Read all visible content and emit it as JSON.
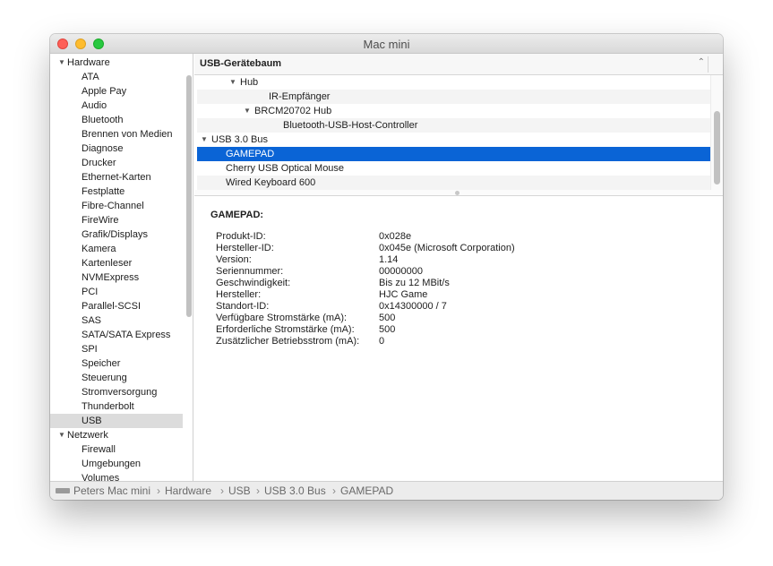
{
  "window": {
    "title": "Mac mini"
  },
  "sidebar": {
    "rows": [
      {
        "label": "Hardware",
        "type": "group"
      },
      {
        "label": "ATA",
        "type": "item"
      },
      {
        "label": "Apple Pay",
        "type": "item"
      },
      {
        "label": "Audio",
        "type": "item"
      },
      {
        "label": "Bluetooth",
        "type": "item"
      },
      {
        "label": "Brennen von Medien",
        "type": "item"
      },
      {
        "label": "Diagnose",
        "type": "item"
      },
      {
        "label": "Drucker",
        "type": "item"
      },
      {
        "label": "Ethernet-Karten",
        "type": "item"
      },
      {
        "label": "Festplatte",
        "type": "item"
      },
      {
        "label": "Fibre-Channel",
        "type": "item"
      },
      {
        "label": "FireWire",
        "type": "item"
      },
      {
        "label": "Grafik/Displays",
        "type": "item"
      },
      {
        "label": "Kamera",
        "type": "item"
      },
      {
        "label": "Kartenleser",
        "type": "item"
      },
      {
        "label": "NVMExpress",
        "type": "item"
      },
      {
        "label": "PCI",
        "type": "item"
      },
      {
        "label": "Parallel-SCSI",
        "type": "item"
      },
      {
        "label": "SAS",
        "type": "item"
      },
      {
        "label": "SATA/SATA Express",
        "type": "item"
      },
      {
        "label": "SPI",
        "type": "item"
      },
      {
        "label": "Speicher",
        "type": "item"
      },
      {
        "label": "Steuerung",
        "type": "item"
      },
      {
        "label": "Stromversorgung",
        "type": "item"
      },
      {
        "label": "Thunderbolt",
        "type": "item"
      },
      {
        "label": "USB",
        "type": "item",
        "selected": true
      },
      {
        "label": "Netzwerk",
        "type": "group"
      },
      {
        "label": "Firewall",
        "type": "item"
      },
      {
        "label": "Umgebungen",
        "type": "item"
      },
      {
        "label": "Volumes",
        "type": "item"
      }
    ]
  },
  "tree": {
    "header": "USB-Gerätebaum",
    "rows": [
      {
        "label": "Hub",
        "level": 2,
        "expanded": true
      },
      {
        "label": "IR-Empfänger",
        "level": 4
      },
      {
        "label": "BRCM20702 Hub",
        "level": 3,
        "expanded": true
      },
      {
        "label": "Bluetooth-USB-Host-Controller",
        "level": 5
      },
      {
        "label": "USB 3.0 Bus",
        "level": 0,
        "expanded": true
      },
      {
        "label": "GAMEPAD",
        "level": 1,
        "selected": true
      },
      {
        "label": "Cherry USB Optical Mouse",
        "level": 1
      },
      {
        "label": "Wired Keyboard 600",
        "level": 1
      }
    ]
  },
  "detail": {
    "title": "GAMEPAD:",
    "rows": [
      {
        "key": "Produkt-ID:",
        "value": "0x028e"
      },
      {
        "key": "Hersteller-ID:",
        "value": "0x045e  (Microsoft Corporation)"
      },
      {
        "key": "Version:",
        "value": "1.14"
      },
      {
        "key": "Seriennummer:",
        "value": "00000000"
      },
      {
        "key": "Geschwindigkeit:",
        "value": "Bis zu 12 MBit/s"
      },
      {
        "key": "Hersteller:",
        "value": "HJC Game"
      },
      {
        "key": "Standort-ID:",
        "value": "0x14300000 / 7"
      },
      {
        "key": "Verfügbare Stromstärke (mA):",
        "value": "500"
      },
      {
        "key": "Erforderliche Stromstärke (mA):",
        "value": "500"
      },
      {
        "key": "Zusätzlicher Betriebsstrom (mA):",
        "value": "0"
      }
    ]
  },
  "pathbar": {
    "icon": "mac-mini-icon",
    "crumbs": [
      "Peters Mac mini",
      "Hardware",
      "USB",
      "USB 3.0 Bus",
      "GAMEPAD"
    ],
    "separator": "›"
  },
  "colors": {
    "selection": "#0a64d6",
    "sidebar_selection": "#dcdcdc"
  }
}
